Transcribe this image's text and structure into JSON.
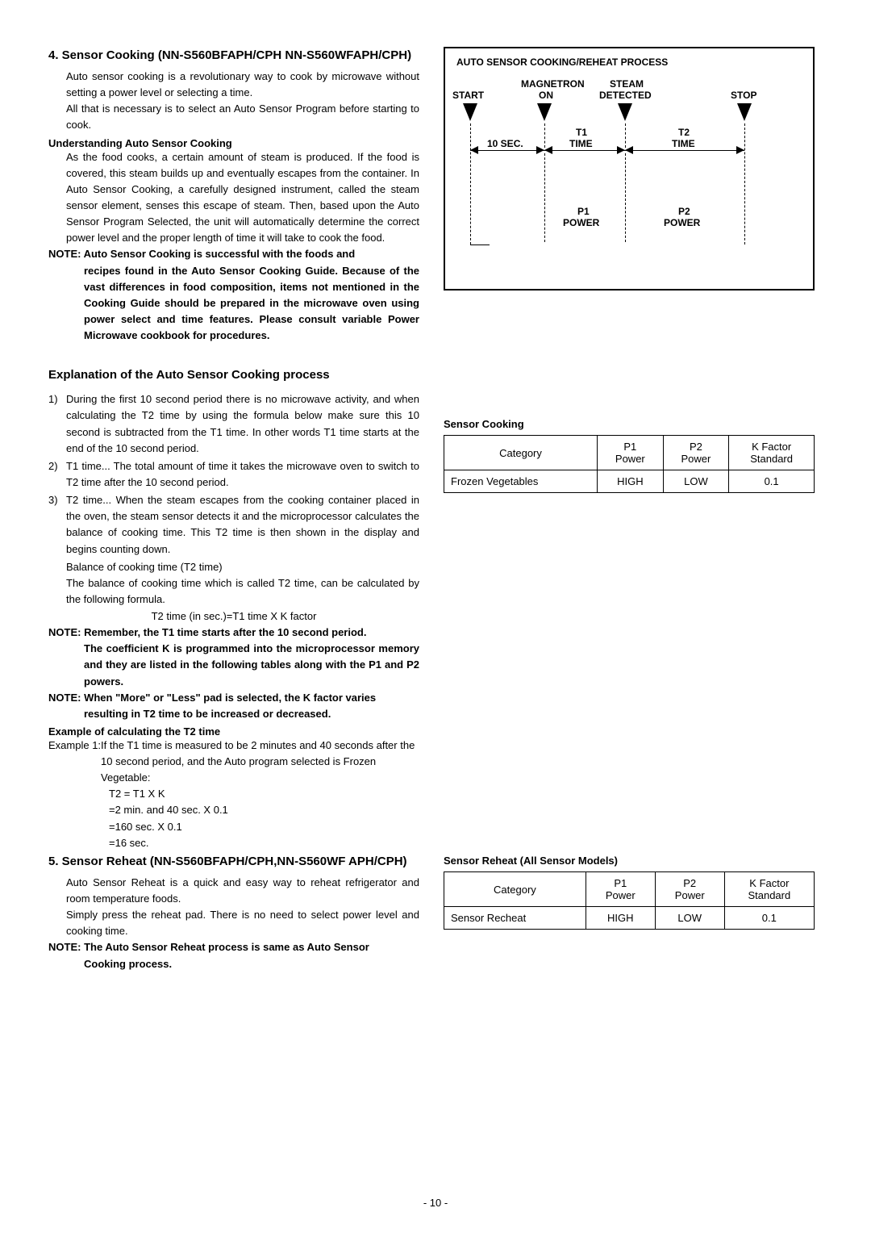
{
  "section4": {
    "title": "4. Sensor Cooking (NN-S560BFAPH/CPH NN-S560WFAPH/CPH)",
    "p1": "Auto sensor cooking is a revolutionary way to cook by microwave without setting a power level or selecting a time.",
    "p2": "All that is necessary is to select an Auto Sensor Program before starting to cook.",
    "sub1": "Understanding Auto Sensor Cooking",
    "p3": "As the food cooks, a certain amount of steam is produced. If the food is covered, this steam builds up and eventually escapes from the container. In Auto Sensor Cooking, a carefully designed instrument, called the steam sensor element, senses this escape of steam. Then, based upon the Auto Sensor Program Selected, the unit will automatically determine the correct power level and the proper length of time it will take to cook the food.",
    "note1_lbl": "NOTE:",
    "note1": "Auto Sensor Cooking is successful with the foods and recipes found in the Auto Sensor Cooking Guide. Because of the vast differences in food composition, items not mentioned in the Cooking Guide should be prepared in the microwave oven using power select and time features. Please consult variable Power Microwave cookbook for procedures."
  },
  "process": {
    "title": "Explanation of the Auto Sensor Cooking process",
    "items": [
      {
        "n": "1)",
        "t": "During the first 10 second period there is no microwave activity, and when calculating the T2 time by using the formula below make sure this 10 second is subtracted from the T1 time. In other words T1 time starts at the end of the 10 second period."
      },
      {
        "n": "2)",
        "t": "T1 time... The total amount of time it takes the microwave oven to switch to T2 time after the 10 second period."
      },
      {
        "n": "3)",
        "t": "T2 time... When the steam escapes from the cooking container placed in the oven, the steam sensor detects it and the microprocessor calculates the balance of cooking time. This T2 time is then shown in the display and begins counting down."
      }
    ],
    "bal1": "Balance of cooking time (T2 time)",
    "bal2": "The balance of cooking time which is called T2 time, can be calculated by the following formula.",
    "formula": "T2 time (in sec.)=T1 time X K factor",
    "note2_lbl": "NOTE:",
    "note2": "Remember, the T1 time starts after the 10 second period. The coefficient K is programmed into the microprocessor memory and they are listed in the following tables along with the P1 and P2 powers.",
    "note3_lbl": "NOTE:",
    "note3": "When \"More\" or \"Less\" pad is selected, the K factor varies resulting in T2 time to be increased or decreased.",
    "ex_title": "Example of calculating the T2 time",
    "ex_lbl": "Example 1: ",
    "ex_body": "If the T1 time is measured to be 2 minutes and 40 seconds after the 10 second period, and the Auto program selected is Frozen Vegetable:",
    "ex_calc": [
      "T2 = T1 X K",
      "=2 min. and 40 sec. X 0.1",
      "=160 sec. X 0.1",
      "=16 sec."
    ]
  },
  "section5": {
    "title": "5. Sensor Reheat (NN-S560BFAPH/CPH,NN-S560WF APH/CPH)",
    "p1": "Auto Sensor Reheat is a quick and easy way to reheat refrigerator and room temperature foods.",
    "p2": "Simply press the reheat pad. There is no need to select power level and cooking time.",
    "note_lbl": "NOTE:",
    "note": "The Auto Sensor Reheat process is same as Auto Sensor Cooking process."
  },
  "diagram": {
    "title": "AUTO SENSOR COOKING/REHEAT PROCESS",
    "labels": {
      "start": "START",
      "magnetron": "MAGNETRON",
      "on": "ON",
      "steam": "STEAM",
      "detected": "DETECTED",
      "stop": "STOP",
      "tensec": "10 SEC.",
      "t1": "T1",
      "time1": "TIME",
      "t2": "T2",
      "time2": "TIME",
      "p1": "P1",
      "power1": "POWER",
      "p2": "P2",
      "power2": "POWER"
    }
  },
  "table1": {
    "title": "Sensor Cooking",
    "headers": [
      "Category",
      "P1\nPower",
      "P2\nPower",
      "K Factor\nStandard"
    ],
    "row": [
      "Frozen Vegetables",
      "HIGH",
      "LOW",
      "0.1"
    ]
  },
  "table2": {
    "title": "Sensor Reheat (All Sensor Models)",
    "headers": [
      "Category",
      "P1\nPower",
      "P2\nPower",
      "K Factor\nStandard"
    ],
    "row": [
      "Sensor Recheat",
      "HIGH",
      "LOW",
      "0.1"
    ]
  },
  "pagenum": "- 10 -"
}
